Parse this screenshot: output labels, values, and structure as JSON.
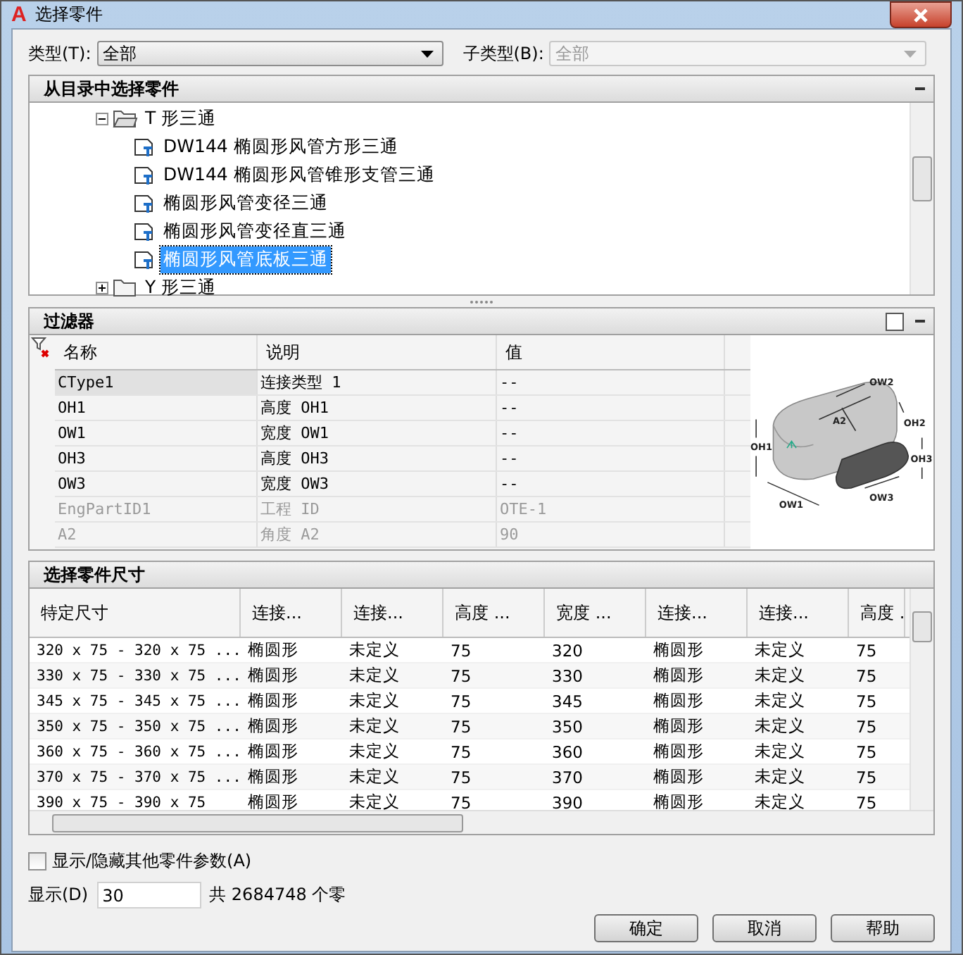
{
  "window": {
    "logo": "A",
    "title": "选择零件"
  },
  "type": {
    "label": "类型(T):",
    "value": "全部",
    "disabled": false
  },
  "subtype": {
    "label": "子类型(B):",
    "value": "全部",
    "disabled": true
  },
  "catalog": {
    "title": "从目录中选择零件",
    "tree": [
      {
        "label": "T 形三通",
        "expanded": true,
        "children": [
          {
            "label": "DW144 椭圆形风管方形三通",
            "selected": false
          },
          {
            "label": "DW144 椭圆形风管锥形支管三通",
            "selected": false
          },
          {
            "label": "椭圆形风管变径三通",
            "selected": false
          },
          {
            "label": "椭圆形风管变径直三通",
            "selected": false
          },
          {
            "label": "椭圆形风管底板三通",
            "selected": true
          }
        ]
      },
      {
        "label": "Y 形三通",
        "expanded": false
      }
    ]
  },
  "filter": {
    "title": "过滤器",
    "columns": [
      "名称",
      "说明",
      "值"
    ],
    "rows": [
      {
        "cells": [
          "CType1",
          "连接类型 1",
          "--"
        ],
        "disabled": false,
        "selected": true
      },
      {
        "cells": [
          "OH1",
          "高度 OH1",
          "--"
        ],
        "disabled": false,
        "selected": false
      },
      {
        "cells": [
          "OW1",
          "宽度 OW1",
          "--"
        ],
        "disabled": false,
        "selected": false
      },
      {
        "cells": [
          "OH3",
          "高度 OH3",
          "--"
        ],
        "disabled": false,
        "selected": false
      },
      {
        "cells": [
          "OW3",
          "宽度 OW3",
          "--"
        ],
        "disabled": false,
        "selected": false
      },
      {
        "cells": [
          "EngPartID1",
          "工程 ID",
          "OTE-1"
        ],
        "disabled": true,
        "selected": false
      },
      {
        "cells": [
          "A2",
          "角度 A2",
          "90"
        ],
        "disabled": true,
        "selected": false
      }
    ],
    "diagram_labels": [
      "OW2",
      "A2",
      "OH2",
      "OH1",
      "OH3",
      "OW3",
      "OW1"
    ]
  },
  "sizes": {
    "title": "选择零件尺寸",
    "columns": [
      "特定尺寸",
      "连接...",
      "连接...",
      "高度 ...",
      "宽度 ...",
      "连接...",
      "连接...",
      "高度 ."
    ],
    "rows": [
      [
        "320 x 75 - 320 x 75 ...",
        "椭圆形",
        "未定义",
        "75",
        "320",
        "椭圆形",
        "未定义",
        "75"
      ],
      [
        "330 x 75 - 330 x 75 ...",
        "椭圆形",
        "未定义",
        "75",
        "330",
        "椭圆形",
        "未定义",
        "75"
      ],
      [
        "345 x 75 - 345 x 75 ...",
        "椭圆形",
        "未定义",
        "75",
        "345",
        "椭圆形",
        "未定义",
        "75"
      ],
      [
        "350 x 75 - 350 x 75 ...",
        "椭圆形",
        "未定义",
        "75",
        "350",
        "椭圆形",
        "未定义",
        "75"
      ],
      [
        "360 x 75 - 360 x 75 ...",
        "椭圆形",
        "未定义",
        "75",
        "360",
        "椭圆形",
        "未定义",
        "75"
      ],
      [
        "370 x 75 - 370 x 75 ...",
        "椭圆形",
        "未定义",
        "75",
        "370",
        "椭圆形",
        "未定义",
        "75"
      ],
      [
        "390 x 75 - 390 x 75",
        "椭圆形",
        "未定义",
        "75",
        "390",
        "椭圆形",
        "未定义",
        "75"
      ]
    ]
  },
  "show_hide": {
    "label": "显示/隐藏其他零件参数(A)",
    "checked": false
  },
  "display": {
    "label": "显示(D)",
    "value": "30",
    "total": "共 2684748 个零"
  },
  "buttons": [
    "确定",
    "取消",
    "帮助"
  ]
}
